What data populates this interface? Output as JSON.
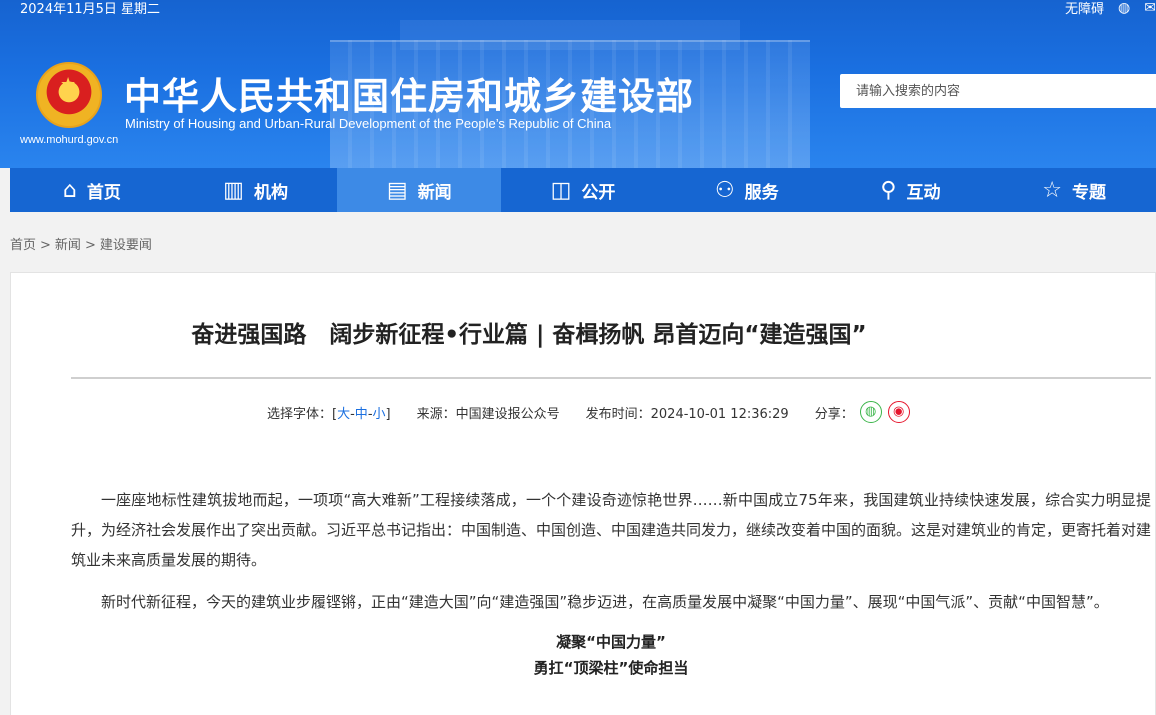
{
  "topbar": {
    "date": "2024年11月5日 星期二",
    "accessibility": "无障碍"
  },
  "header": {
    "title_cn": "中华人民共和国住房和城乡建设部",
    "title_en": "Ministry of Housing and Urban-Rural Development of the People’s Republic of China",
    "url": "www.mohurd.gov.cn",
    "search_placeholder": "请输入搜索的内容"
  },
  "nav": {
    "items": [
      {
        "label": "首页",
        "icon": "home-icon"
      },
      {
        "label": "机构",
        "icon": "building-icon"
      },
      {
        "label": "新闻",
        "icon": "news-icon"
      },
      {
        "label": "公开",
        "icon": "open-icon"
      },
      {
        "label": "服务",
        "icon": "service-icon"
      },
      {
        "label": "互动",
        "icon": "interact-icon"
      },
      {
        "label": "专题",
        "icon": "topic-icon"
      }
    ],
    "active": "新闻"
  },
  "breadcrumb": [
    "首页",
    "新闻",
    "建设要闻"
  ],
  "article": {
    "title": "奋进强国路　阔步新征程•行业篇 | 奋楫扬帆 昂首迈向“建造强国”",
    "font_select_label": "选择字体：[",
    "font_large": "大",
    "font_medium": "中",
    "font_small": "小",
    "font_close": "]",
    "source": "来源：中国建设报公众号",
    "publish_time": "发布时间：2024-10-01 12:36:29",
    "share_label": "分享：",
    "paragraphs": [
      "一座座地标性建筑拔地而起，一项项“高大难新”工程接续落成，一个个建设奇迹惊艳世界……新中国成立75年来，我国建筑业持续快速发展，综合实力明显提升，为经济社会发展作出了突出贡献。习近平总书记指出：中国制造、中国创造、中国建造共同发力，继续改变着中国的面貌。这是对建筑业的肯定，更寄托着对建筑业未来高质量发展的期待。",
      "新时代新征程，今天的建筑业步履铿锵，正由“建造大国”向“建造强国”稳步迈进，在高质量发展中凝聚“中国力量”、展现“中国气派”、贡献“中国智慧”。"
    ],
    "subhead1": "凝聚“中国力量”",
    "subhead2": "勇扛“顶梁柱”使命担当"
  },
  "colors": {
    "header_blue": "#1a6fe0",
    "nav_blue": "#1666d2",
    "nav_active": "#3d8ae6",
    "link_blue": "#1a6fe0"
  }
}
